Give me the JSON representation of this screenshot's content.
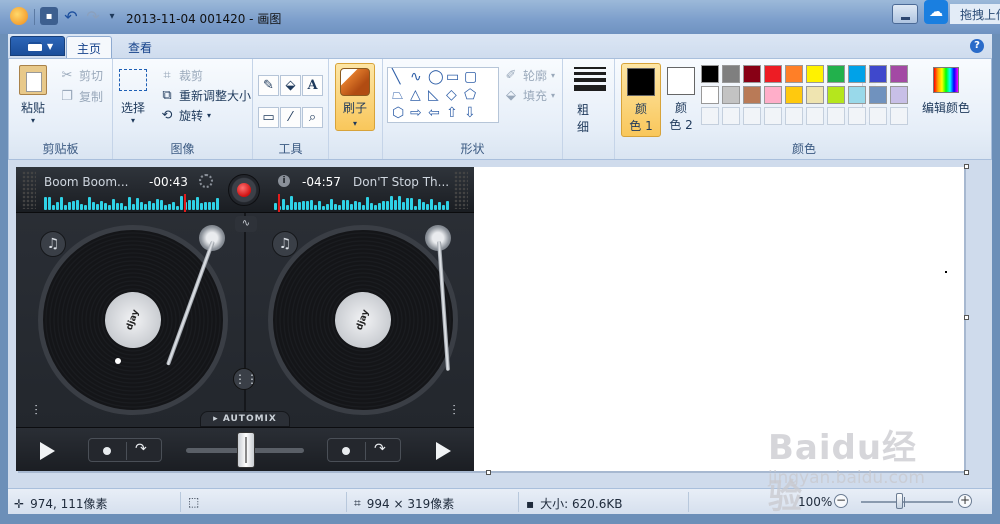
{
  "window": {
    "title": "2013-11-04 001420 - 画图",
    "cloud_text": "拖拽上传"
  },
  "tabs": {
    "home": "主页",
    "view": "查看"
  },
  "ribbon": {
    "clipboard": {
      "label": "剪贴板",
      "paste": "粘贴",
      "cut": "剪切",
      "copy": "复制"
    },
    "image": {
      "label": "图像",
      "select": "选择",
      "crop": "裁剪",
      "resize": "重新调整大小",
      "rotate": "旋转"
    },
    "tools": {
      "label": "工具",
      "text_glyph": "A"
    },
    "brushes": {
      "label": "刷子"
    },
    "shapes": {
      "label": "形状",
      "outline": "轮廓",
      "fill": "填充"
    },
    "size": {
      "label_top": "粗",
      "label_bottom": "细"
    },
    "colors": {
      "label": "颜色",
      "color1_top": "颜",
      "color1_bottom": "色 1",
      "color2_top": "颜",
      "color2_bottom": "色 2",
      "edit": "编辑颜色",
      "color1_value": "#000000",
      "color2_value": "#ffffff",
      "palette_row1": [
        "#000000",
        "#7f7f7f",
        "#880015",
        "#ed1c24",
        "#ff7f27",
        "#fff200",
        "#22b14c",
        "#00a2e8",
        "#3f48cc",
        "#a349a4"
      ],
      "palette_row2": [
        "#ffffff",
        "#c3c3c3",
        "#b97a57",
        "#ffaec9",
        "#ffc90e",
        "#efe4b0",
        "#b5e61d",
        "#99d9ea",
        "#7092be",
        "#c8bfe7"
      ]
    }
  },
  "dj_app": {
    "left_track": "Boom Boom...",
    "left_time": "-00:43",
    "right_track": "Don'T Stop Th...",
    "right_time": "-04:57",
    "label_text": "djay",
    "automix": "AUTOMIX"
  },
  "status": {
    "cursor_pos": "974, 111像素",
    "canvas_size": "994 × 319像素",
    "file_size": "大小: 620.6KB",
    "zoom": "100%"
  },
  "watermark": {
    "logo": "Baidu经验",
    "url": "jingyan.baidu.com"
  }
}
